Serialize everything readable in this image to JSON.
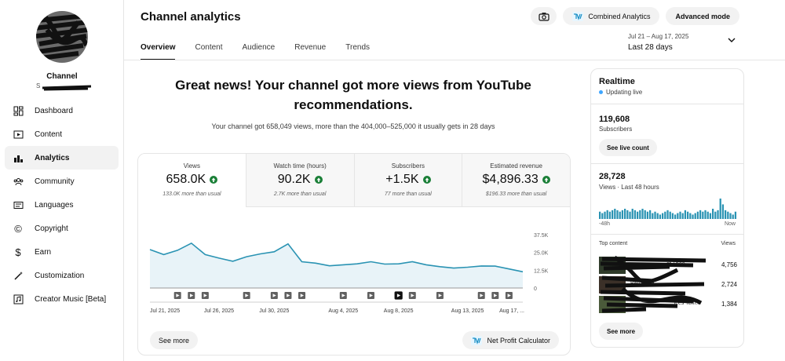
{
  "sidebar": {
    "channel_label": "Channel",
    "handle_prefix": "S",
    "items": [
      {
        "label": "Dashboard",
        "icon": "dashboard-icon"
      },
      {
        "label": "Content",
        "icon": "content-icon"
      },
      {
        "label": "Analytics",
        "icon": "analytics-icon"
      },
      {
        "label": "Community",
        "icon": "community-icon"
      },
      {
        "label": "Languages",
        "icon": "languages-icon"
      },
      {
        "label": "Copyright",
        "icon": "copyright-icon"
      },
      {
        "label": "Earn",
        "icon": "dollar-icon"
      },
      {
        "label": "Customization",
        "icon": "magic-wand-icon"
      },
      {
        "label": "Creator Music [Beta]",
        "icon": "music-icon"
      }
    ],
    "active_index": 2
  },
  "header": {
    "title": "Channel analytics",
    "tabs": [
      "Overview",
      "Content",
      "Audience",
      "Revenue",
      "Trends"
    ],
    "active_tab": 0,
    "buttons": {
      "camera_icon": "camera-icon",
      "combined": "Combined Analytics",
      "advanced": "Advanced mode"
    },
    "date_range": "Jul 21 – Aug 17, 2025",
    "period": "Last 28 days"
  },
  "hero": {
    "title": "Great news! Your channel got more views from YouTube recommendations.",
    "subtitle": "Your channel got 658,049 views, more than the 404,000–525,000 it usually gets in 28 days"
  },
  "metrics": [
    {
      "label": "Views",
      "value": "658.0K",
      "note": "133.0K more than usual"
    },
    {
      "label": "Watch time (hours)",
      "value": "90.2K",
      "note": "2.7K more than usual"
    },
    {
      "label": "Subscribers",
      "value": "+1.5K",
      "note": "77 more than usual"
    },
    {
      "label": "Estimated revenue",
      "value": "$4,896.33",
      "note": "$196.33 more than usual"
    }
  ],
  "main_card": {
    "see_more": "See more",
    "net_profit": "Net Profit Calculator"
  },
  "chart_data": {
    "type": "area",
    "x": [
      "Jul 21",
      "Jul 22",
      "Jul 23",
      "Jul 24",
      "Jul 25",
      "Jul 26",
      "Jul 27",
      "Jul 28",
      "Jul 29",
      "Jul 30",
      "Jul 31",
      "Aug 1",
      "Aug 2",
      "Aug 3",
      "Aug 4",
      "Aug 5",
      "Aug 6",
      "Aug 7",
      "Aug 8",
      "Aug 9",
      "Aug 10",
      "Aug 11",
      "Aug 12",
      "Aug 13",
      "Aug 14",
      "Aug 15",
      "Aug 16",
      "Aug 17"
    ],
    "x_tick_labels": [
      "Jul 21, 2025",
      "Jul 26, 2025",
      "Jul 30, 2025",
      "Aug 4, 2025",
      "Aug 8, 2025",
      "Aug 13, 2025",
      "Aug 17, ..."
    ],
    "x_tick_indices": [
      0,
      5,
      9,
      14,
      18,
      23,
      27
    ],
    "series": [
      {
        "values": [
          27000,
          23500,
          26500,
          31500,
          23500,
          21000,
          18800,
          22000,
          24000,
          25500,
          31000,
          18500,
          17500,
          15600,
          16300,
          17000,
          18500,
          16800,
          17000,
          18500,
          16300,
          15000,
          14000,
          14600,
          15500,
          15400,
          13400,
          11400
        ]
      }
    ],
    "y_ticks": [
      "37.5K",
      "25.0K",
      "12.5K",
      "0"
    ],
    "ylim": [
      0,
      37500
    ],
    "video_marker_indices": [
      2,
      3,
      4,
      7,
      9,
      10,
      11,
      14,
      16,
      18,
      19,
      21,
      24,
      25,
      26
    ],
    "highlighted_marker_index": 18,
    "grid": false
  },
  "realtime": {
    "title": "Realtime",
    "updating": "Updating live",
    "subscribers_value": "119,608",
    "subscribers_label": "Subscribers",
    "see_live_count": "See live count",
    "views_value": "28,728",
    "views_label": "Views · Last 48 hours",
    "spark_left": "-48h",
    "spark_right": "Now",
    "spark_values": [
      5,
      4,
      5,
      6,
      5,
      6,
      7,
      6,
      5,
      6,
      7,
      6,
      5,
      7,
      6,
      5,
      6,
      7,
      6,
      5,
      6,
      4,
      5,
      4,
      3,
      4,
      5,
      6,
      5,
      4,
      3,
      4,
      5,
      4,
      6,
      5,
      4,
      3,
      4,
      5,
      6,
      5,
      6,
      5,
      4,
      7,
      5,
      6,
      14,
      10,
      6,
      5,
      4,
      3,
      5
    ],
    "top_content_label": "Top content",
    "views_col_label": "Views",
    "top_content": [
      {
        "title": "of Thee",
        "views": "4,756"
      },
      {
        "title": "Bern",
        "views": "2,724"
      },
      {
        "title": "...ices Tem...",
        "views": "1,384"
      }
    ],
    "see_more": "See more"
  }
}
